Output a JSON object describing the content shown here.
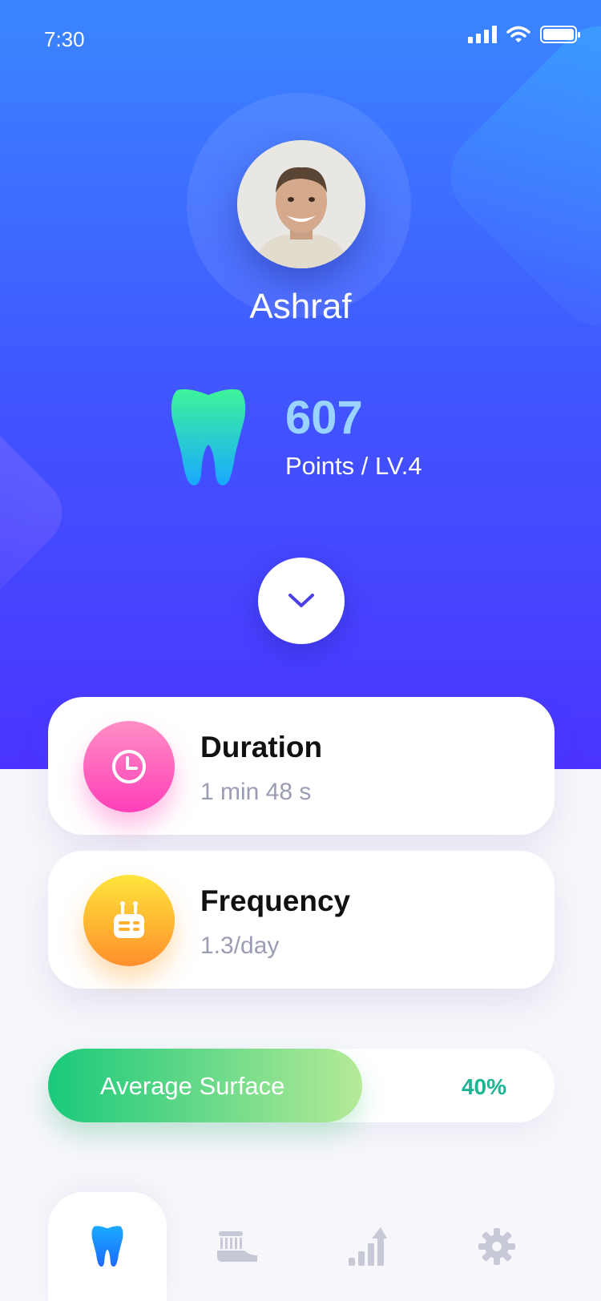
{
  "status_bar": {
    "time": "7:30"
  },
  "profile": {
    "name": "Ashraf"
  },
  "points": {
    "value": "607",
    "label": "Points / LV.4"
  },
  "stats": [
    {
      "title": "Duration",
      "value": "1 min 48 s",
      "icon": "clock-icon"
    },
    {
      "title": "Frequency",
      "value": "1.3/day",
      "icon": "toothbrush-head-icon"
    }
  ],
  "surface": {
    "label": "Average Surface",
    "value_text": "40%",
    "progress": 0.62
  },
  "tabs": [
    {
      "icon": "tooth-icon",
      "active": true
    },
    {
      "icon": "toothbrush-icon",
      "active": false
    },
    {
      "icon": "chart-up-icon",
      "active": false
    },
    {
      "icon": "gear-icon",
      "active": false
    }
  ],
  "colors": {
    "hero_top": "#3a86ff",
    "hero_bottom": "#4b34ff",
    "points_accent": "#9ad3ff",
    "duration_icon": "#ff3fb9",
    "frequency_icon": "#ff8f2c",
    "surface_fill_start": "#1ac97b",
    "surface_value": "#1ab592",
    "tab_active": "#1e8cff",
    "tab_inactive": "#c8c9d6"
  }
}
